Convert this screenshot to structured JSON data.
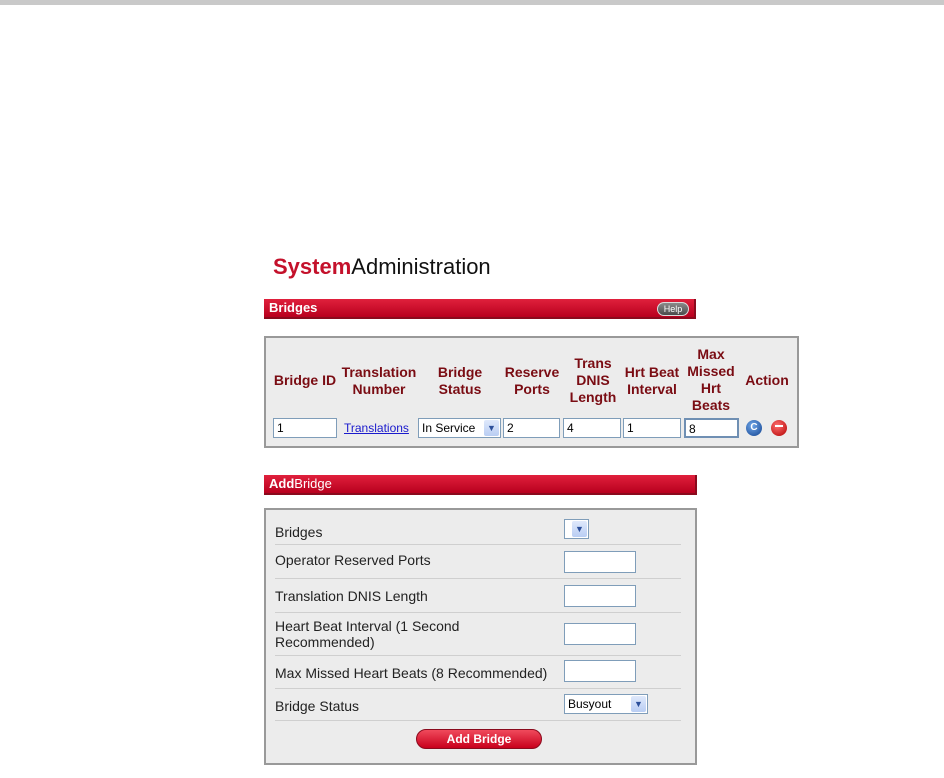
{
  "page": {
    "title_bold": "System",
    "title_rest": "Administration"
  },
  "bridges_section": {
    "title": "Bridges",
    "help_label": "Help",
    "columns": [
      "Bridge ID",
      "Translation\nNumber",
      "Bridge\nStatus",
      "Reserve\nPorts",
      "Trans\nDNIS\nLength",
      "Hrt Beat\nInterval",
      "Max\nMissed\nHrt\nBeats",
      "Action"
    ],
    "row": {
      "bridge_id": "1",
      "translation_link": "Translations",
      "bridge_status": "In Service",
      "reserve_ports": "2",
      "trans_dnis_length": "4",
      "hrt_beat_interval": "1",
      "max_missed_hrt_beats": "8",
      "action_change_icon": "C",
      "action_delete_icon": "minus-circle"
    }
  },
  "add_bridge_section": {
    "title_bold": "Add",
    "title_rest": "Bridge",
    "fields": {
      "bridges_label": "Bridges",
      "bridges_value": "",
      "operator_reserved_ports_label": "Operator Reserved Ports",
      "translation_dnis_length_label": "Translation DNIS Length",
      "heart_beat_interval_label_line1": "Heart Beat Interval (1 Second",
      "heart_beat_interval_label_line2": "Recommended)",
      "max_missed_heart_beats_label": "Max Missed Heart Beats (8 Recommended)",
      "bridge_status_label": "Bridge Status",
      "bridge_status_value": "Busyout"
    },
    "add_button_label": "Add Bridge"
  }
}
